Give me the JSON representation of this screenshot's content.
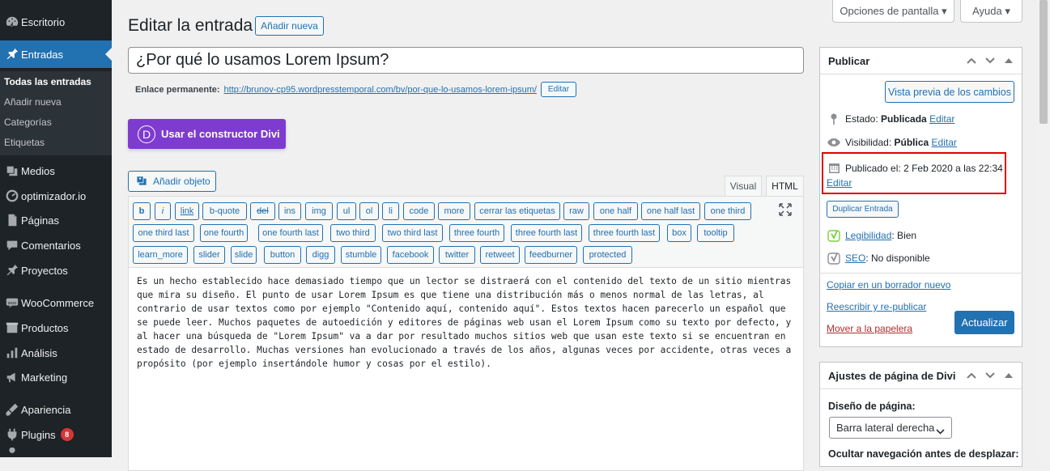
{
  "sidebar": {
    "items": [
      {
        "label": "Escritorio",
        "icon": "dashboard-icon"
      },
      {
        "label": "Entradas",
        "icon": "pin-icon",
        "current": true
      },
      {
        "label": "Medios",
        "icon": "media-icon"
      },
      {
        "label": "optimizador.io",
        "icon": "optimizer-icon"
      },
      {
        "label": "Páginas",
        "icon": "pages-icon"
      },
      {
        "label": "Comentarios",
        "icon": "comments-icon"
      },
      {
        "label": "Proyectos",
        "icon": "pin-icon"
      },
      {
        "label": "WooCommerce",
        "icon": "woocommerce-icon"
      },
      {
        "label": "Productos",
        "icon": "products-icon"
      },
      {
        "label": "Análisis",
        "icon": "analytics-icon"
      },
      {
        "label": "Marketing",
        "icon": "marketing-icon"
      },
      {
        "label": "Apariencia",
        "icon": "appearance-icon"
      },
      {
        "label": "Plugins",
        "icon": "plugins-icon",
        "badge": "8"
      }
    ],
    "submenu": [
      "Todas las entradas",
      "Añadir nueva",
      "Categorías",
      "Etiquetas"
    ]
  },
  "header": {
    "title": "Editar la entrada",
    "add_new": "Añadir nueva",
    "screen_options": "Opciones de pantalla ▾",
    "help": "Ayuda ▾"
  },
  "post": {
    "title": "¿Por qué lo usamos Lorem Ipsum?",
    "permalink_label": "Enlace permanente:",
    "permalink_url": "http://brunov-cp95.wordpresstemporal.com/bv/por-que-lo-usamos-lorem-ipsum/",
    "permalink_edit": "Editar",
    "divi_button": "Usar el constructor Divi",
    "divi_letter": "D",
    "add_media": "Añadir objeto",
    "tab_visual": "Visual",
    "tab_html": "HTML",
    "quicktags": [
      [
        "b",
        "i",
        "link",
        "b-quote",
        "del",
        "ins",
        "img",
        "ul",
        "ol",
        "li",
        "code",
        "more",
        "cerrar las etiquetas",
        "raw",
        "one half",
        "one half last",
        "one third"
      ],
      [
        "one third last",
        "one fourth",
        "one fourth last",
        "two third",
        "two third last",
        "three fourth",
        "three fourth last",
        "three fourth last",
        "box",
        "tooltip"
      ],
      [
        "learn_more",
        "slider",
        "slide",
        "button",
        "digg",
        "stumble",
        "facebook",
        "twitter",
        "retweet",
        "feedburner",
        "protected"
      ]
    ],
    "content": "Es un hecho establecido hace demasiado tiempo que un lector se distraerá con el contenido del texto de un sitio mientras que mira su diseño. El punto de usar Lorem Ipsum es que tiene una distribución más o menos normal de las letras, al contrario de usar textos como por ejemplo \"Contenido aquí, contenido aquí\". Estos textos hacen parecerlo un español que se puede leer. Muchos paquetes de autoedición y editores de páginas web usan el Lorem Ipsum como su texto por defecto, y al hacer una búsqueda de \"Lorem Ipsum\" va a dar por resultado muchos sitios web que usan este texto si se encuentran en estado de desarrollo. Muchas versiones han evolucionado a través de los años, algunas veces por accidente, otras veces a propósito (por ejemplo insertándole humor y cosas por el estilo)."
  },
  "publish": {
    "title": "Publicar",
    "preview": "Vista previa de los cambios",
    "status_label": "Estado:",
    "status_value": "Publicada",
    "visibility_label": "Visibilidad:",
    "visibility_value": "Pública",
    "edit": "Editar",
    "published_label": "Publicado el:",
    "published_value": "2 Feb 2020 a las 22:34",
    "duplicate": "Duplicar Entrada",
    "readability_label": "Legibilidad",
    "readability_value": ": Bien",
    "seo_label": "SEO",
    "seo_value": ": No disponible",
    "copy_draft": "Copiar en un borrador nuevo",
    "rewrite": "Reescribir y re-publicar",
    "trash": "Mover a la papelera",
    "update": "Actualizar"
  },
  "divi_settings": {
    "title": "Ajustes de página de Divi",
    "layout_label": "Diseño de página:",
    "layout_value": "Barra lateral derecha",
    "hide_nav_label": "Ocultar navegación antes de desplazar:"
  },
  "colors": {
    "accent": "#2271b1",
    "divi_purple": "#7e3bd0",
    "highlight": "#e00000",
    "sidebar_bg": "#1d2327"
  }
}
